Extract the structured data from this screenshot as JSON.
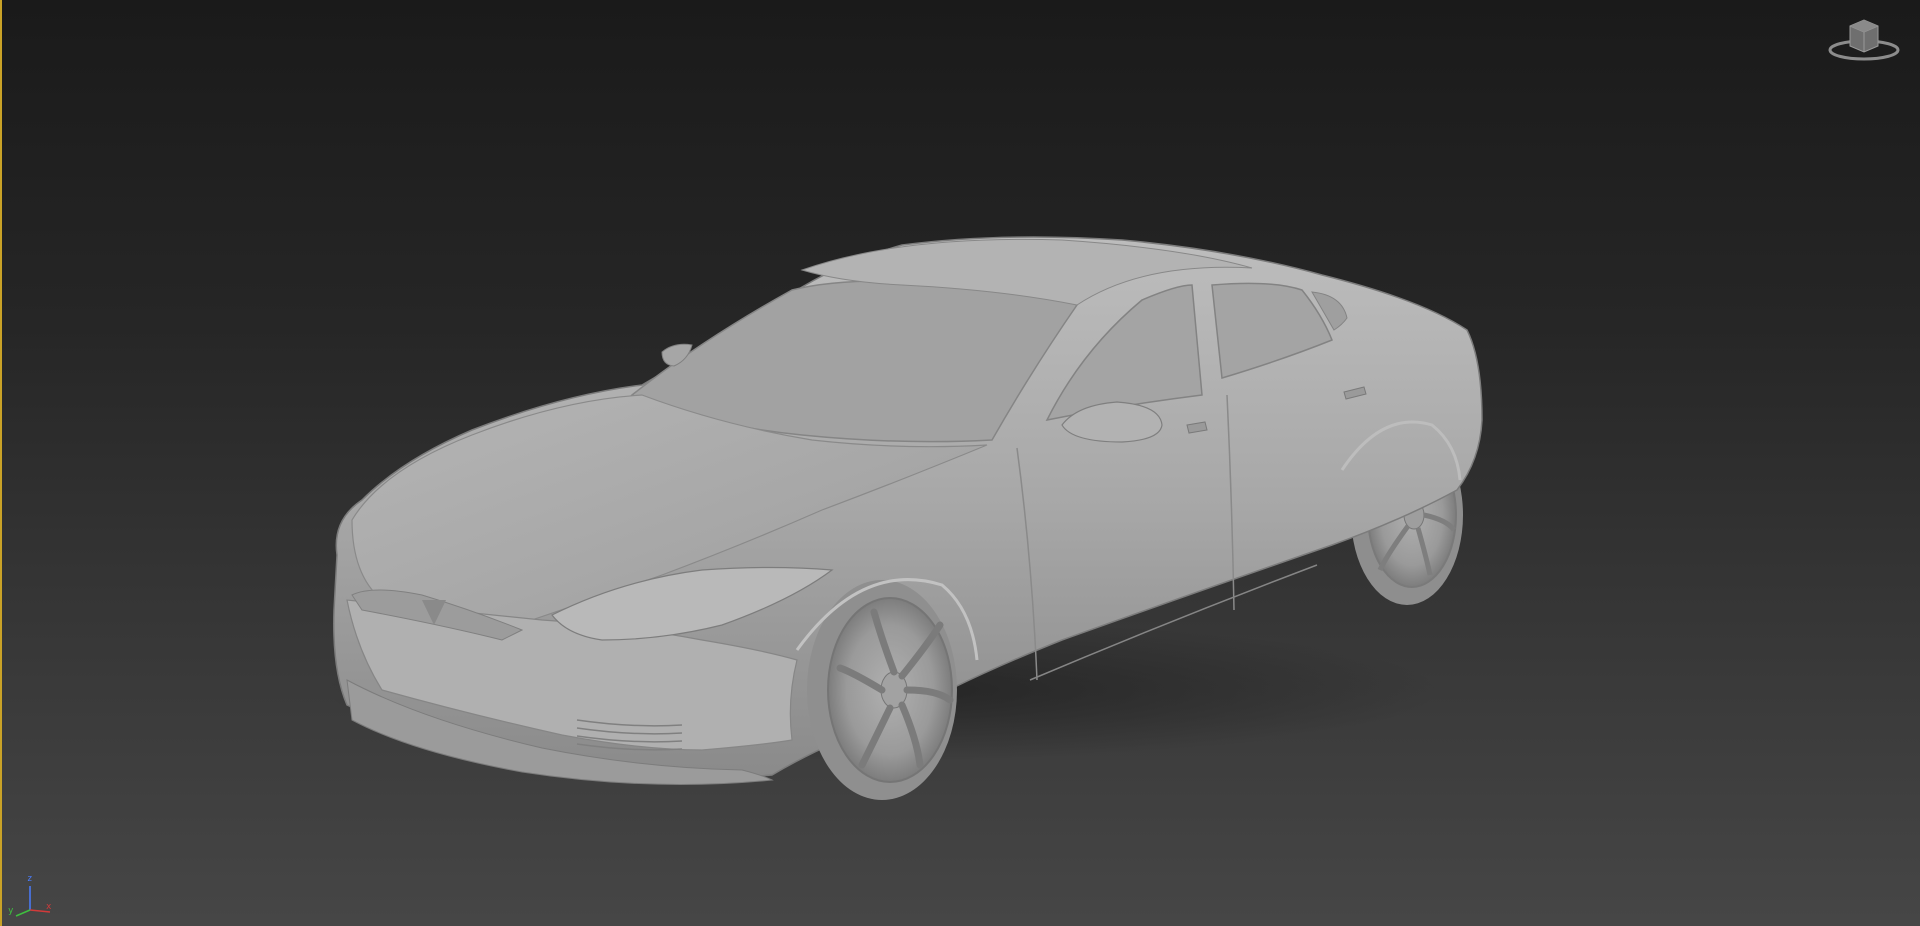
{
  "viewport": {
    "background_top": "#1a1a1a",
    "background_bottom": "#464646",
    "active_border_color": "#c9a227",
    "model_color": "#a9a9a9"
  },
  "navigation": {
    "viewcube_icon": "viewcube-icon",
    "axis_icon": "axis-tripod-icon"
  },
  "axes": {
    "x_label": "x",
    "y_label": "y",
    "z_label": "z",
    "x_color": "#d23a3a",
    "y_color": "#3fbf3f",
    "z_color": "#4a7dff"
  }
}
